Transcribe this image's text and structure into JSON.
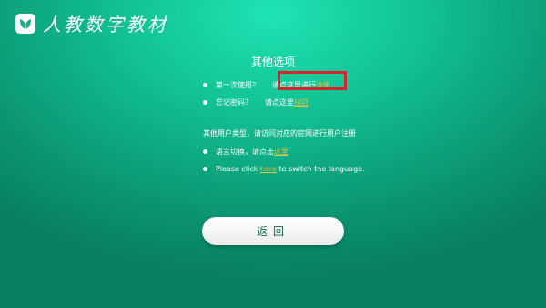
{
  "header": {
    "logo_icon": "leaf-book-icon",
    "logo_text": "人教数字教材"
  },
  "page": {
    "title": "其他选项"
  },
  "options": {
    "first_use": {
      "label": "第一次使用？",
      "prompt": "请点这里进行",
      "link": "注册"
    },
    "forgot_password": {
      "label": "忘记密码？",
      "prompt": "请点这里",
      "link": "找回"
    }
  },
  "other_users": {
    "text": "其他用户类型，请访问对应的官网进行用户注册"
  },
  "language": {
    "cn_prompt": "语言切换，请点击",
    "cn_link": "这里",
    "en_before": "Please click ",
    "en_link": "here",
    "en_after": " to switch the language."
  },
  "back_button": {
    "label": "返回"
  },
  "colors": {
    "background": "#12c395",
    "link": "#e6c24a",
    "highlight": "#d9232a"
  }
}
